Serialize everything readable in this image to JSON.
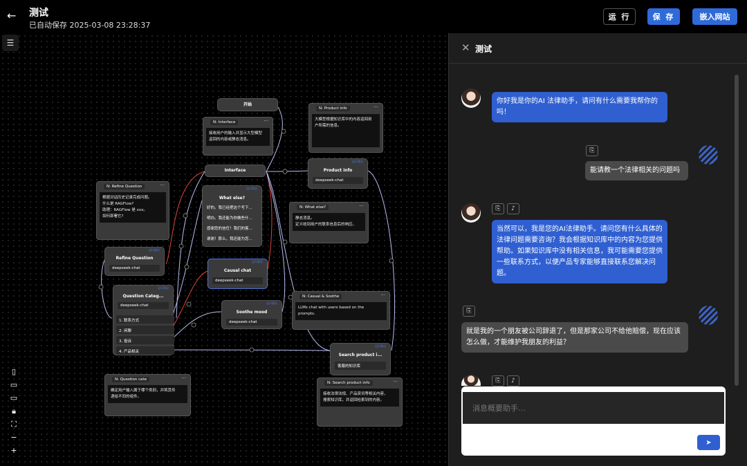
{
  "header": {
    "title": "测试",
    "autosave": "已自动保存 2025-03-08 23:28:37",
    "run_label": "运 行",
    "save_label": "保 存",
    "embed_label": "嵌入网站"
  },
  "nodes": {
    "start": "开始",
    "interface": "Interface",
    "product_info": "Product info",
    "product_info_model": "deepseek-chat",
    "what_else": "What else?",
    "what_else_lines": [
      "好的。我已经把这个写下...",
      "明白。我还能为你做些什...",
      "感谢您的信任！我们的客...",
      "谢谢！那么，我还能为您..."
    ],
    "refine_question": "Refine Question",
    "refine_model": "deepseek-chat",
    "causal_chat": "Causal chat",
    "causal_model": "deepseek-chat",
    "question_categ": "Question Categ...",
    "question_model": "deepseek-chat",
    "options": [
      "1. 联系方式",
      "2. 闲聊",
      "3. 投诉",
      "4. 产品相关"
    ],
    "soothe_mood": "Soothe mood",
    "soothe_model": "deepseek-chat",
    "search_product": "Search product i...",
    "search_kb": "客服的知识库",
    "run_tag": "运行情况"
  },
  "notes": {
    "interface_title": "N: Interface",
    "interface_body": "接收用户的输入并显示大型模型\n返回的内容或静态消息。",
    "product_info_title": "N: Product info",
    "product_info_body": "大模型根据知识库中的内容返回用\n户所需的信息。",
    "refine_title": "N: Refine Question",
    "refine_body": "根据对话历史记录完成问题。\n什么是 RAGFlow?\n助理：RAGFlow 是 xxx。\n如何部署它?",
    "what_else_title": "N: What else?",
    "what_else_body": "静态消息。\n定义收到用户的联系信息后的响应。",
    "casual_title": "N: Casual & Soothe",
    "casual_body": "LLMs chat with users based on the\nprompts.",
    "question_cate_title": "N: Question cate",
    "question_cate_body": "确定用户输入属于哪个类别，并将其传\n递给不同的组件。",
    "search_title": "N: Search product info",
    "search_body": "接收法律法规、产品资讯等相关内容，\n搜索知识库，并返回检索到的内容。"
  },
  "panel": {
    "title": "测试",
    "messages": [
      {
        "role": "assistant",
        "text": "你好我是你的AI 法律助手，请问有什么需要我帮你的吗！"
      },
      {
        "role": "user",
        "text": "能请教一个法律相关的问题吗"
      },
      {
        "role": "assistant",
        "text": "当然可以，我是您的AI法律助手。请问您有什么具体的法律问题需要咨询？我会根据知识库中的内容为您提供帮助。如果知识库中没有相关信息，我可能需要您提供一些联系方式，以便产品专家能够直接联系您解决问题。"
      },
      {
        "role": "user",
        "text": "就是我的一个朋友被公司辞退了，但是那家公司不给他赔偿，现在应该怎么做，才能维护我朋友的利益？"
      }
    ],
    "input_placeholder": "消息概要助手..."
  }
}
